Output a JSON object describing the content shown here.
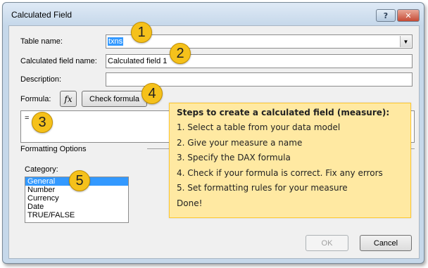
{
  "window": {
    "title": "Calculated Field",
    "help_glyph": "?",
    "close_glyph": "✕"
  },
  "form": {
    "table_name_label": "Table name:",
    "table_name_value": "txns",
    "calc_field_label": "Calculated field name:",
    "calc_field_value": "Calculated field 1",
    "description_label": "Description:",
    "description_value": "",
    "formula_label": "Formula:",
    "fx_label": "fx",
    "check_formula_label": "Check formula",
    "formula_value": "="
  },
  "formatting": {
    "section_label": "Formatting Options",
    "category_label": "Category:",
    "categories": [
      "General",
      "Number",
      "Currency",
      "Date",
      "TRUE/FALSE"
    ],
    "selected_category": "General"
  },
  "buttons": {
    "ok_label": "OK",
    "cancel_label": "Cancel"
  },
  "steps_callout": {
    "title": "Steps to create a calculated field (measure):",
    "lines": [
      "1. Select a table from your data model",
      "2. Give your measure a name",
      "3. Specify the DAX formula",
      "4. Check if your formula is correct. Fix any errors",
      "5. Set formatting rules for your measure",
      "Done!"
    ]
  },
  "badges": [
    "1",
    "2",
    "3",
    "4",
    "5"
  ],
  "colors": {
    "badge": "#f5c11b",
    "callout_bg": "#ffe9a2",
    "selection": "#3399ff"
  }
}
